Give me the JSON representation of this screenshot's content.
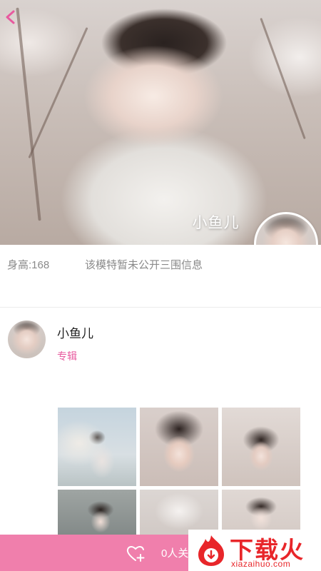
{
  "hero": {
    "model_name": "小鱼儿",
    "back_icon": "chevron-left-icon",
    "accent_color": "#e85a9f"
  },
  "info": {
    "height": "身高:168",
    "measurements": "该模特暂未公开三围信息"
  },
  "profile": {
    "name": "小鱼儿",
    "album_link": "专辑"
  },
  "gallery": {
    "thumbnails": [
      "photo-1",
      "photo-2",
      "photo-3",
      "photo-4",
      "photo-5",
      "photo-6"
    ]
  },
  "bottom_bar": {
    "follow_label": "0人关",
    "follow_icon": "heart-plus-icon",
    "bar_color": "#f07fac"
  },
  "watermark": {
    "title": "下载火",
    "url": "xiazaihuo.com",
    "color": "#e8262a"
  }
}
